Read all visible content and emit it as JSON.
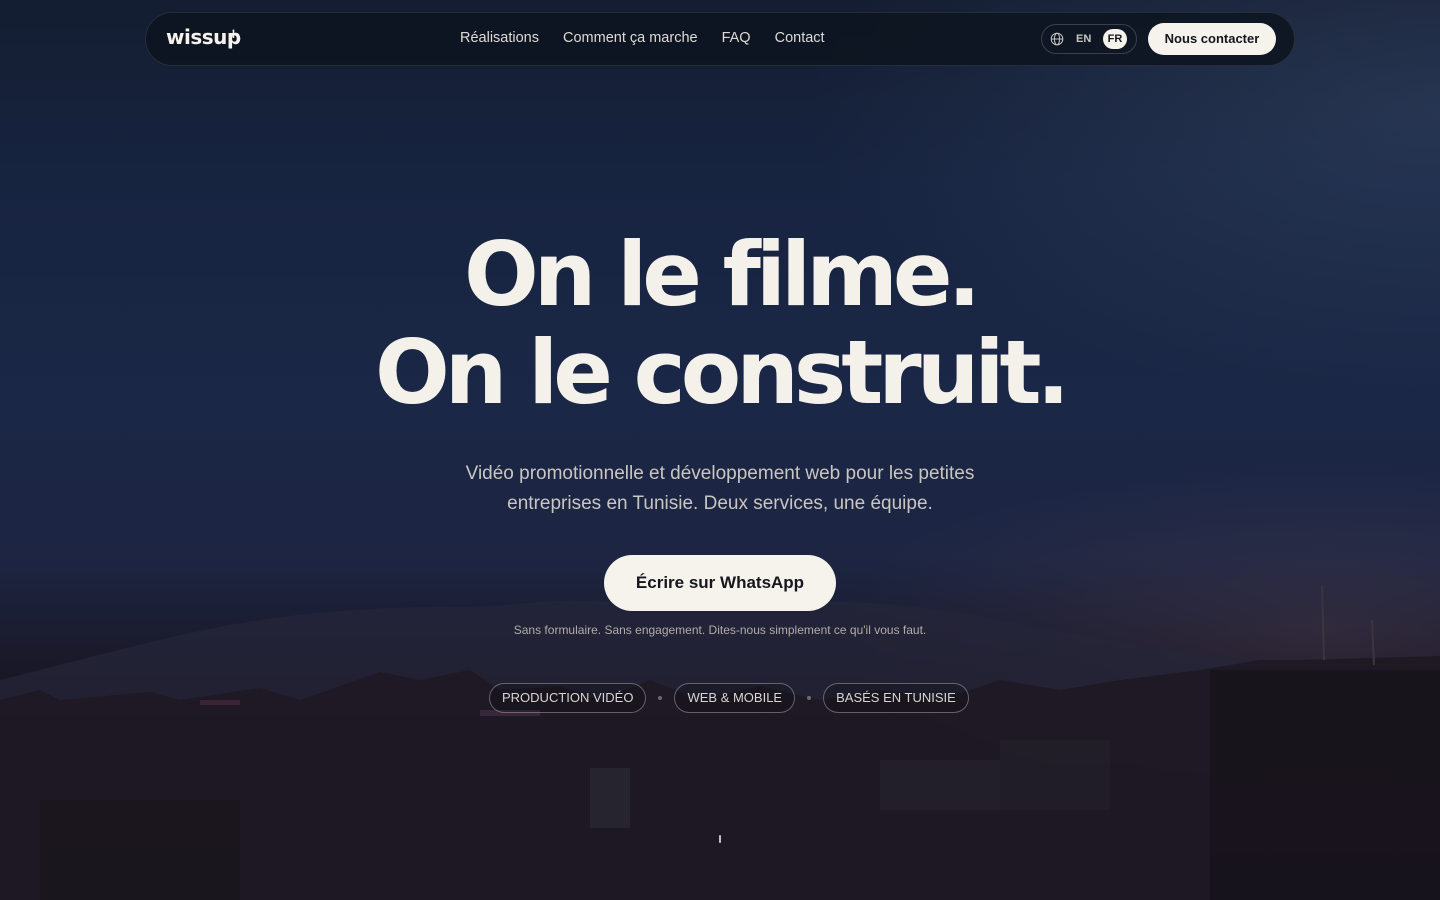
{
  "brand": {
    "logo_text": "wissup",
    "logo_plus": "+"
  },
  "nav": {
    "links": [
      {
        "label": "Réalisations"
      },
      {
        "label": "Comment ça marche"
      },
      {
        "label": "FAQ"
      },
      {
        "label": "Contact"
      }
    ],
    "language": {
      "icon": "globe-icon",
      "options": [
        "EN",
        "FR"
      ],
      "selected": "FR"
    },
    "cta_label": "Nous contacter"
  },
  "hero": {
    "title_line1": "On le filme.",
    "title_line2": "On le construit.",
    "subtitle": "Vidéo promotionnelle et développement web pour les petites entreprises en Tunisie. Deux services, une équipe.",
    "cta_label": "Écrire sur WhatsApp",
    "cta_note": "Sans formulaire. Sans engagement. Dites-nous simplement ce qu'il vous faut.",
    "tags": [
      "PRODUCTION VIDÉO",
      "WEB & MOBILE",
      "BASÉS EN TUNISIE"
    ]
  },
  "colors": {
    "background_top": "#141d31",
    "background_bottom": "#120f14",
    "text_light": "#f4f0ea",
    "button_bg": "#f6f2ec",
    "button_text": "#15171d"
  }
}
